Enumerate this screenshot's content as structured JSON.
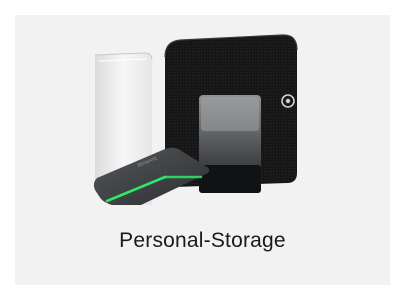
{
  "card": {
    "label": "Personal-Storage",
    "image_icon": "storage-products-image"
  },
  "colors": {
    "card_background": "#f2f2f2",
    "label_text": "#1a1a1a",
    "led_green": "#2ee86a"
  }
}
